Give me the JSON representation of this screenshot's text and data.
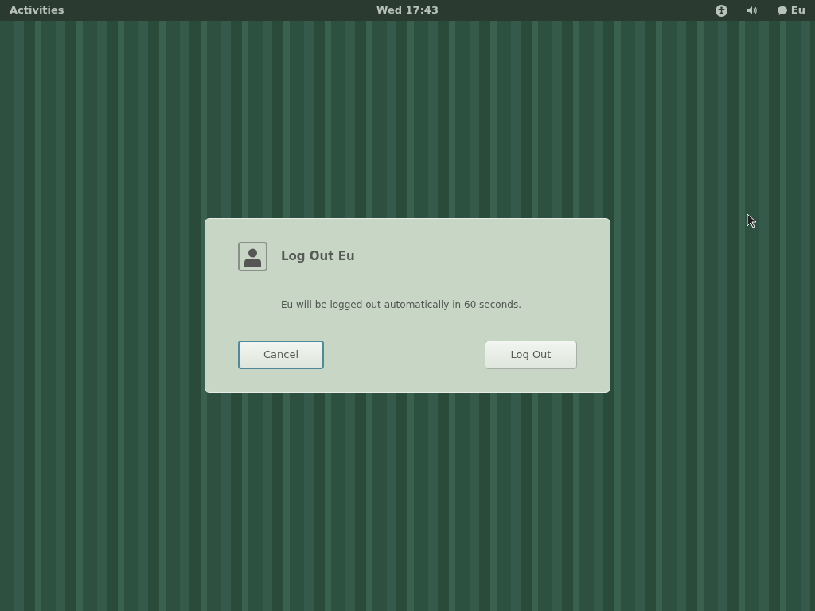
{
  "top_bar": {
    "activities": "Activities",
    "clock": "Wed 17:43",
    "user": "Eu"
  },
  "dialog": {
    "title": "Log Out Eu",
    "message": "Eu will be logged out automatically in 60 seconds.",
    "buttons": [
      {
        "label": "Cancel",
        "focused": true
      },
      {
        "label": "Log Out",
        "focused": false
      }
    ]
  }
}
